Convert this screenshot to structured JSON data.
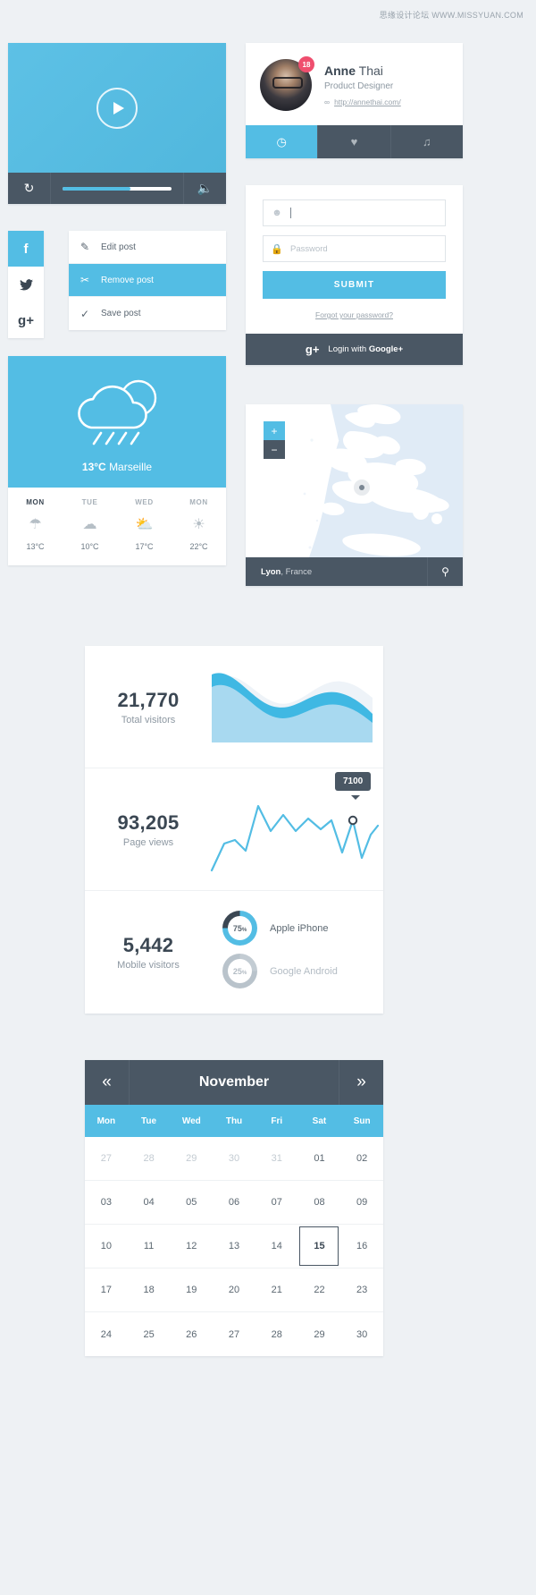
{
  "watermark": "思缘设计论坛 WWW.MISSYUAN.COM",
  "colors": {
    "accent": "#53bde4",
    "dark": "#4a5764",
    "badge": "#ef4e6e",
    "bg": "#eef1f4"
  },
  "video_player": {
    "play_icon": "play-icon",
    "loop_icon": "loop-icon",
    "volume_icon": "volume-icon",
    "progress_percent": 62
  },
  "social": [
    {
      "name": "facebook",
      "glyph": "f"
    },
    {
      "name": "twitter",
      "glyph": "✈"
    },
    {
      "name": "googleplus",
      "glyph": "g+"
    }
  ],
  "post_actions": [
    {
      "label": "Edit post",
      "icon": "pencil-icon",
      "glyph": "✎",
      "active": false
    },
    {
      "label": "Remove post",
      "icon": "scissors-icon",
      "glyph": "✂",
      "active": true
    },
    {
      "label": "Save post",
      "icon": "check-icon",
      "glyph": "✓",
      "active": false
    }
  ],
  "weather": {
    "current_icon": "cloud-rain-sun-icon",
    "temperature": "13°C",
    "city": "Marseille",
    "forecast": [
      {
        "day": "MON",
        "icon": "rain-icon",
        "glyph": "☂",
        "temp": "13°C",
        "today": true
      },
      {
        "day": "TUE",
        "icon": "cloud-icon",
        "glyph": "☁",
        "temp": "10°C",
        "today": false
      },
      {
        "day": "WED",
        "icon": "partly-cloudy-icon",
        "glyph": "⛅",
        "temp": "17°C",
        "today": false
      },
      {
        "day": "MON",
        "icon": "sun-icon",
        "glyph": "☀",
        "temp": "22°C",
        "today": false
      }
    ]
  },
  "profile": {
    "badge_count": "18",
    "first_name": "Anne",
    "last_name": "Thai",
    "role": "Product Designer",
    "link_icon": "link-icon",
    "link_text": "http://annethai.com/",
    "tabs": [
      {
        "name": "clock",
        "glyph": "◷",
        "active": true
      },
      {
        "name": "heart",
        "glyph": "♥",
        "active": false
      },
      {
        "name": "music",
        "glyph": "♫",
        "active": false
      }
    ]
  },
  "login": {
    "username": {
      "icon": "user-icon",
      "value": "",
      "placeholder": ""
    },
    "password": {
      "icon": "lock-icon",
      "value": "",
      "placeholder": "Password"
    },
    "submit_label": "SUBMIT",
    "forgot_label": "Forgot your password?",
    "google_glyph": "g+",
    "google_label_plain": "Login with ",
    "google_label_bold": "Google+"
  },
  "map": {
    "zoom_in": "+",
    "zoom_out": "−",
    "city": "Lyon",
    "country": ", France",
    "pin_icon": "location-pin-icon"
  },
  "stats": [
    {
      "number": "21,770",
      "label": "Total visitors",
      "chart": "area"
    },
    {
      "number": "93,205",
      "label": "Page views",
      "chart": "line",
      "tooltip": "7100"
    },
    {
      "number": "5,442",
      "label": "Mobile visitors",
      "chart": "donuts"
    }
  ],
  "donuts": [
    {
      "pct_num": "75",
      "pct_sym": "%",
      "label": "Apple iPhone",
      "value": 75,
      "muted": false
    },
    {
      "pct_num": "25",
      "pct_sym": "%",
      "label": "Google Android",
      "value": 25,
      "muted": true
    }
  ],
  "calendar": {
    "prev_icon": "chevron-left-icon",
    "prev_glyph": "«",
    "next_icon": "chevron-right-icon",
    "next_glyph": "»",
    "month": "November",
    "dow": [
      "Mon",
      "Tue",
      "Wed",
      "Thu",
      "Fri",
      "Sat",
      "Sun"
    ],
    "weeks": [
      [
        {
          "d": "27",
          "m": true
        },
        {
          "d": "28",
          "m": true
        },
        {
          "d": "29",
          "m": true
        },
        {
          "d": "30",
          "m": true
        },
        {
          "d": "31",
          "m": true
        },
        {
          "d": "01",
          "m": false
        },
        {
          "d": "02",
          "m": false
        }
      ],
      [
        {
          "d": "03",
          "m": false
        },
        {
          "d": "04",
          "m": false
        },
        {
          "d": "05",
          "m": false
        },
        {
          "d": "06",
          "m": false
        },
        {
          "d": "07",
          "m": false
        },
        {
          "d": "08",
          "m": false
        },
        {
          "d": "09",
          "m": false
        }
      ],
      [
        {
          "d": "10",
          "m": false
        },
        {
          "d": "11",
          "m": false
        },
        {
          "d": "12",
          "m": false
        },
        {
          "d": "13",
          "m": false
        },
        {
          "d": "14",
          "m": false
        },
        {
          "d": "15",
          "m": false,
          "today": true
        },
        {
          "d": "16",
          "m": false
        }
      ],
      [
        {
          "d": "17",
          "m": false
        },
        {
          "d": "18",
          "m": false
        },
        {
          "d": "19",
          "m": false
        },
        {
          "d": "20",
          "m": false
        },
        {
          "d": "21",
          "m": false
        },
        {
          "d": "22",
          "m": false
        },
        {
          "d": "23",
          "m": false
        }
      ],
      [
        {
          "d": "24",
          "m": false
        },
        {
          "d": "25",
          "m": false
        },
        {
          "d": "26",
          "m": false
        },
        {
          "d": "27",
          "m": false
        },
        {
          "d": "28",
          "m": false
        },
        {
          "d": "29",
          "m": false
        },
        {
          "d": "30",
          "m": false
        }
      ]
    ]
  },
  "chart_data": [
    {
      "type": "area",
      "title": "Total visitors",
      "total": 21770,
      "x": [
        0,
        1,
        2,
        3,
        4,
        5,
        6,
        7,
        8,
        9,
        10
      ],
      "series": [
        {
          "name": "front-wave",
          "values": [
            62,
            70,
            78,
            72,
            58,
            46,
            52,
            66,
            74,
            70,
            60
          ]
        },
        {
          "name": "back-wave",
          "values": [
            40,
            55,
            72,
            84,
            80,
            62,
            48,
            44,
            56,
            72,
            78
          ]
        }
      ],
      "grid": false,
      "legend": "none"
    },
    {
      "type": "line",
      "title": "Page views",
      "total": 93205,
      "x": [
        0,
        1,
        2,
        3,
        4,
        5,
        6,
        7,
        8,
        9,
        10,
        11,
        12,
        13,
        14,
        15
      ],
      "series": [
        {
          "name": "Page views",
          "values": [
            1200,
            4200,
            4800,
            3900,
            8600,
            5200,
            7600,
            5600,
            7200,
            6000,
            7100,
            3200,
            7100,
            2900,
            5600,
            6400
          ]
        }
      ],
      "annotations": [
        {
          "label": "7100",
          "x": 12,
          "y": 7100
        }
      ],
      "ylabel": "",
      "xlabel": "",
      "grid": false,
      "legend": "none"
    },
    {
      "type": "pie",
      "title": "Mobile visitors",
      "total": 5442,
      "labels": [
        "Apple iPhone",
        "Google Android"
      ],
      "values": [
        75,
        25
      ],
      "legend": "right"
    }
  ]
}
